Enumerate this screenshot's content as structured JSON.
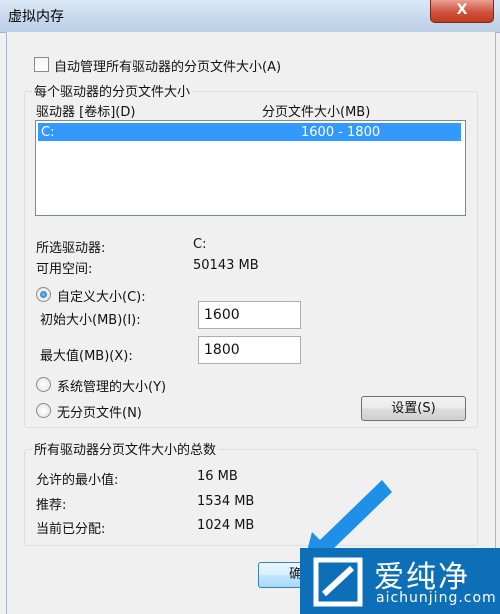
{
  "window": {
    "title": "虚拟内存",
    "close_glyph": "X"
  },
  "auto_manage": {
    "label": "自动管理所有驱动器的分页文件大小(A)",
    "checked": false
  },
  "per_drive_group": {
    "caption": "每个驱动器的分页文件大小",
    "col_drive": "驱动器 [卷标](D)",
    "col_size": "分页文件大小(MB)",
    "rows": [
      {
        "drive": "C:",
        "size": "1600 - 1800",
        "selected": true
      }
    ],
    "selected_drive_label": "所选驱动器:",
    "selected_drive_value": "C:",
    "free_space_label": "可用空间:",
    "free_space_value": "50143 MB",
    "custom_size_label": "自定义大小(C):",
    "initial_size_label": "初始大小(MB)(I):",
    "initial_size_value": "1600",
    "max_size_label": "最大值(MB)(X):",
    "max_size_value": "1800",
    "system_managed_label": "系统管理的大小(Y)",
    "no_paging_label": "无分页文件(N)",
    "set_button": "设置(S)",
    "selected_option": "custom"
  },
  "total_group": {
    "caption": "所有驱动器分页文件大小的总数",
    "min_label": "允许的最小值:",
    "min_value": "16 MB",
    "recommended_label": "推荐:",
    "recommended_value": "1534 MB",
    "current_label": "当前已分配:",
    "current_value": "1024 MB"
  },
  "footer": {
    "ok_button": "确"
  },
  "watermark": {
    "cn": "爱纯净",
    "en": "aichunjing.com"
  },
  "colors": {
    "selection": "#3399ff",
    "arrow": "#1e90e8",
    "logo_bg": "#0d6fb8"
  }
}
